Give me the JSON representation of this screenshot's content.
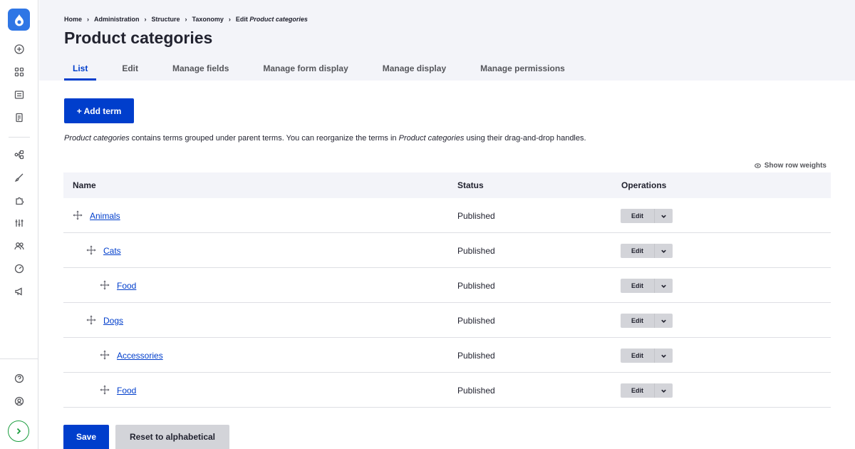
{
  "sidebar": {
    "logo_icon": "drupal-drop-icon",
    "top_icons": [
      "add-icon",
      "grid-icon",
      "content-icon",
      "files-icon"
    ],
    "middle_icons": [
      "structure-icon",
      "appearance-icon",
      "extend-icon",
      "config-icon",
      "people-icon",
      "reports-icon",
      "announce-icon"
    ],
    "bottom_icons": [
      "help-icon",
      "user-icon"
    ],
    "expand_icon": "chevron-right-icon"
  },
  "breadcrumb": {
    "items": [
      "Home",
      "Administration",
      "Structure",
      "Taxonomy"
    ],
    "current_prefix": "Edit ",
    "current_em": "Product categories",
    "separator": "›"
  },
  "page_title": "Product categories",
  "tabs": [
    {
      "label": "List",
      "active": true
    },
    {
      "label": "Edit"
    },
    {
      "label": "Manage fields"
    },
    {
      "label": "Manage form display"
    },
    {
      "label": "Manage display"
    },
    {
      "label": "Manage permissions"
    }
  ],
  "add_term_label": "+ Add term",
  "description": {
    "em1": "Product categories",
    "text1": " contains terms grouped under parent terms. You can reorganize the terms in ",
    "em2": "Product categories",
    "text2": " using their drag-and-drop handles."
  },
  "show_row_weights": "Show row weights",
  "table": {
    "headers": {
      "name": "Name",
      "status": "Status",
      "operations": "Operations"
    },
    "rows": [
      {
        "name": "Animals",
        "depth": 0,
        "status": "Published",
        "op": "Edit"
      },
      {
        "name": "Cats",
        "depth": 1,
        "status": "Published",
        "op": "Edit"
      },
      {
        "name": "Food",
        "depth": 2,
        "status": "Published",
        "op": "Edit"
      },
      {
        "name": "Dogs",
        "depth": 1,
        "status": "Published",
        "op": "Edit"
      },
      {
        "name": "Accessories",
        "depth": 2,
        "status": "Published",
        "op": "Edit"
      },
      {
        "name": "Food",
        "depth": 2,
        "status": "Published",
        "op": "Edit"
      }
    ]
  },
  "actions": {
    "save": "Save",
    "reset": "Reset to alphabetical"
  },
  "colors": {
    "primary": "#003ecc",
    "logo": "#2f76e5",
    "expand": "#1a9d3e"
  }
}
